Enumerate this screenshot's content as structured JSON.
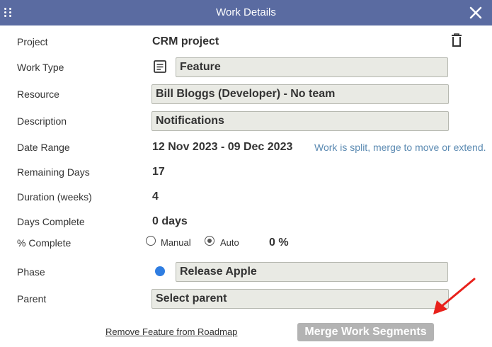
{
  "dialog": {
    "title": "Work Details",
    "header_color": "#5a6ba1"
  },
  "fields": {
    "project": {
      "label": "Project",
      "value": "CRM project"
    },
    "work_type": {
      "label": "Work Type",
      "value": "Feature",
      "icon": "document-icon"
    },
    "resource": {
      "label": "Resource",
      "value": "Bill Bloggs (Developer) - No team"
    },
    "description": {
      "label": "Description",
      "value": "Notifications"
    },
    "date_range": {
      "label": "Date Range",
      "value": "12 Nov 2023 - 09 Dec 2023",
      "note": "Work is split, merge to move or extend."
    },
    "remaining_days": {
      "label": "Remaining Days",
      "value": "17"
    },
    "duration_weeks": {
      "label": "Duration (weeks)",
      "value": "4"
    },
    "days_complete": {
      "label": "Days Complete",
      "value": "0 days"
    },
    "percent_complete": {
      "label": "% Complete",
      "options": [
        "Manual",
        "Auto"
      ],
      "selected": "Auto",
      "value": "0 %"
    },
    "phase": {
      "label": "Phase",
      "value": "Release Apple",
      "color": "#2f7de1"
    },
    "parent": {
      "label": "Parent",
      "value": "Select parent"
    }
  },
  "actions": {
    "remove_label": "Remove Feature from Roadmap",
    "merge_label": "Merge Work Segments"
  },
  "icons": {
    "drag": "drag-handle-icon",
    "close": "close-icon",
    "delete": "trash-icon",
    "annotation": "red-arrow-annotation"
  }
}
